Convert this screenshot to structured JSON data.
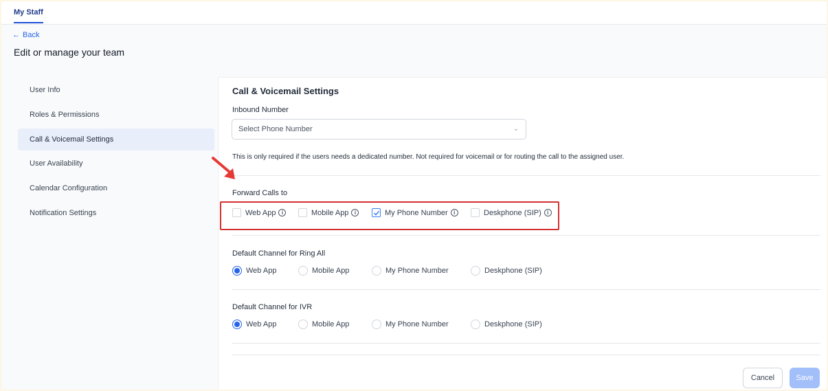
{
  "topbar": {
    "tab_label": "My Staff"
  },
  "nav": {
    "back_label": "Back",
    "page_title": "Edit or manage your team"
  },
  "sidebar": {
    "items": [
      {
        "label": "User Info",
        "active": false
      },
      {
        "label": "Roles & Permissions",
        "active": false
      },
      {
        "label": "Call & Voicemail Settings",
        "active": true
      },
      {
        "label": "User Availability",
        "active": false
      },
      {
        "label": "Calendar Configuration",
        "active": false
      },
      {
        "label": "Notification Settings",
        "active": false
      }
    ]
  },
  "main": {
    "title": "Call & Voicemail Settings",
    "inbound": {
      "label": "Inbound Number",
      "placeholder": "Select Phone Number",
      "help": "This is only required if the users needs a dedicated number. Not required for voicemail or for routing the call to the assigned user."
    },
    "forward": {
      "label": "Forward Calls to",
      "options": [
        {
          "label": "Web App",
          "checked": false
        },
        {
          "label": "Mobile App",
          "checked": false
        },
        {
          "label": "My Phone Number",
          "checked": true
        },
        {
          "label": "Deskphone (SIP)",
          "checked": false
        }
      ]
    },
    "ring_all": {
      "label": "Default Channel for Ring All",
      "options": [
        "Web App",
        "Mobile App",
        "My Phone Number",
        "Deskphone (SIP)"
      ],
      "selected": "Web App"
    },
    "ivr": {
      "label": "Default Channel for IVR",
      "options": [
        "Web App",
        "Mobile App",
        "My Phone Number",
        "Deskphone (SIP)"
      ],
      "selected": "Web App"
    },
    "buttons": {
      "cancel": "Cancel",
      "save": "Save"
    }
  },
  "icons": {
    "info": "info-circle-icon",
    "chevron": "chevron-down-icon",
    "back": "arrow-left-icon",
    "annotation": "red-arrow-icon"
  },
  "colors": {
    "accent": "#2563eb",
    "annotation": "#d32f2f",
    "save_disabled": "#a3bffa",
    "active_nav": "#e8effb"
  }
}
